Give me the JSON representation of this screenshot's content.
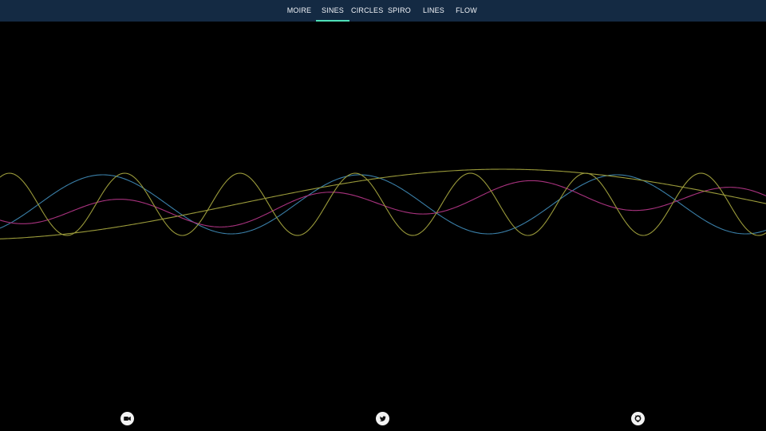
{
  "nav": {
    "tabs": [
      {
        "label": "MOIRE",
        "active": false
      },
      {
        "label": "SINES",
        "active": true
      },
      {
        "label": "CIRCLES",
        "active": false
      },
      {
        "label": "SPIRO",
        "active": false
      },
      {
        "label": "LINES",
        "active": false
      },
      {
        "label": "FLOW",
        "active": false
      }
    ]
  },
  "colors": {
    "background": "#000000",
    "topbar": "#142a43",
    "accent": "#4fe0b8",
    "wave_blue": "#3a7fa8",
    "wave_magenta": "#a8327e",
    "wave_olive": "#9a9a3a",
    "social_icon_bg": "#f3f3f3"
  },
  "social_links": [
    {
      "icon": "video-camera-icon"
    },
    {
      "icon": "twitter-icon"
    },
    {
      "icon": "github-icon"
    }
  ]
}
